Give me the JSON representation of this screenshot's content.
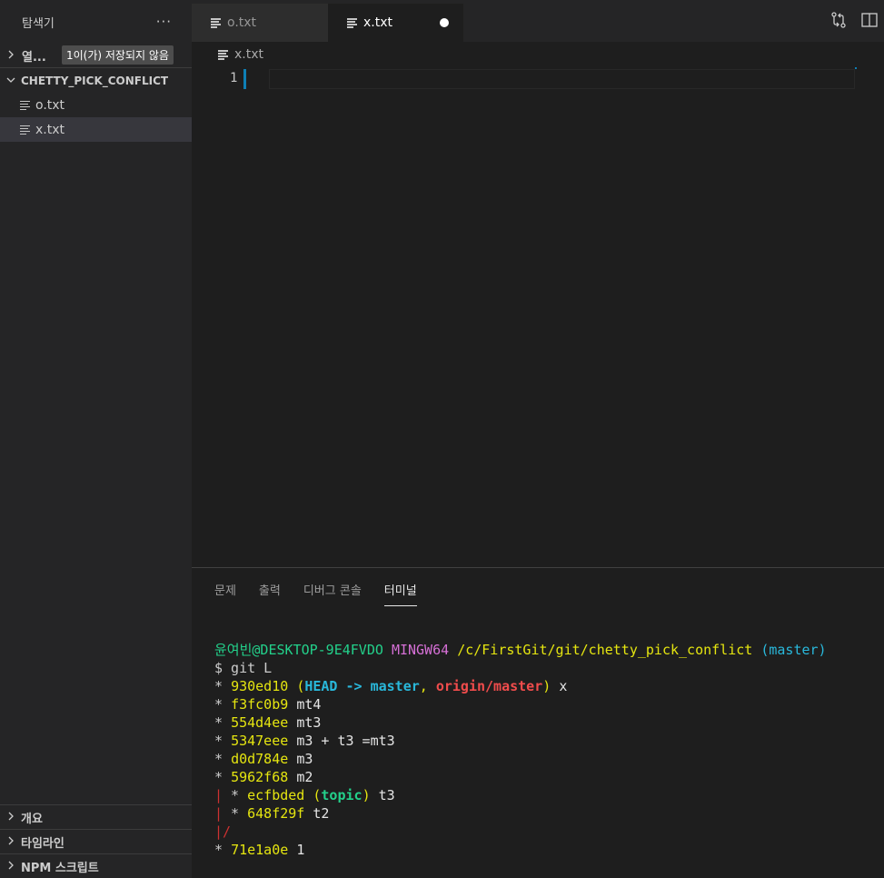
{
  "sidebar": {
    "title": "탐색기",
    "more": "···",
    "open_editors": {
      "label": "열...",
      "badge": "1이(가) 저장되지 않음"
    },
    "folder": {
      "name": "CHETTY_PICK_CONFLICT",
      "files": [
        "o.txt",
        "x.txt"
      ]
    },
    "bottom_sections": [
      "개요",
      "타임라인",
      "NPM 스크립트"
    ]
  },
  "tabs": [
    {
      "label": "o.txt"
    },
    {
      "label": "x.txt"
    }
  ],
  "breadcrumb": "x.txt",
  "editor": {
    "line_number": "1"
  },
  "panel": {
    "tabs": [
      "문제",
      "출력",
      "디버그 콘솔",
      "터미널"
    ]
  },
  "terminal": {
    "prompt_user": "윤여빈@DESKTOP-9E4FVDO",
    "prompt_env": "MINGW64",
    "prompt_path": "/c/FirstGit/git/chetty_pick_conflict",
    "prompt_branch": "(master)",
    "command": "$ git L",
    "log": [
      {
        "graph": "* ",
        "hash": "930ed10",
        "head": "HEAD -> master",
        "origin": "origin/master",
        "msg": "x"
      },
      {
        "graph": "* ",
        "hash": "f3fc0b9",
        "msg": "mt4"
      },
      {
        "graph": "* ",
        "hash": "554d4ee",
        "msg": "mt3"
      },
      {
        "graph": "* ",
        "hash": "5347eee",
        "msg": "m3 + t3 =mt3"
      },
      {
        "graph": "* ",
        "hash": "d0d784e",
        "msg": "m3"
      },
      {
        "graph": "* ",
        "hash": "5962f68",
        "msg": "m2"
      },
      {
        "graph_bar": "|",
        "graph": " * ",
        "hash": "ecfbded",
        "topic": "topic",
        "msg": "t3"
      },
      {
        "graph_bar": "|",
        "graph": " * ",
        "hash": "648f29f",
        "msg": "t2"
      },
      {
        "graph_bar": "|/"
      },
      {
        "graph": "* ",
        "hash": "71e1a0e",
        "msg": "1"
      }
    ]
  },
  "colors": {
    "accent": "#0e7fb5",
    "terminal_green": "#23d18b",
    "terminal_yellow": "#e5e510",
    "terminal_red": "#f14c4c",
    "terminal_cyan": "#29b8db",
    "terminal_magenta": "#d670d6"
  }
}
